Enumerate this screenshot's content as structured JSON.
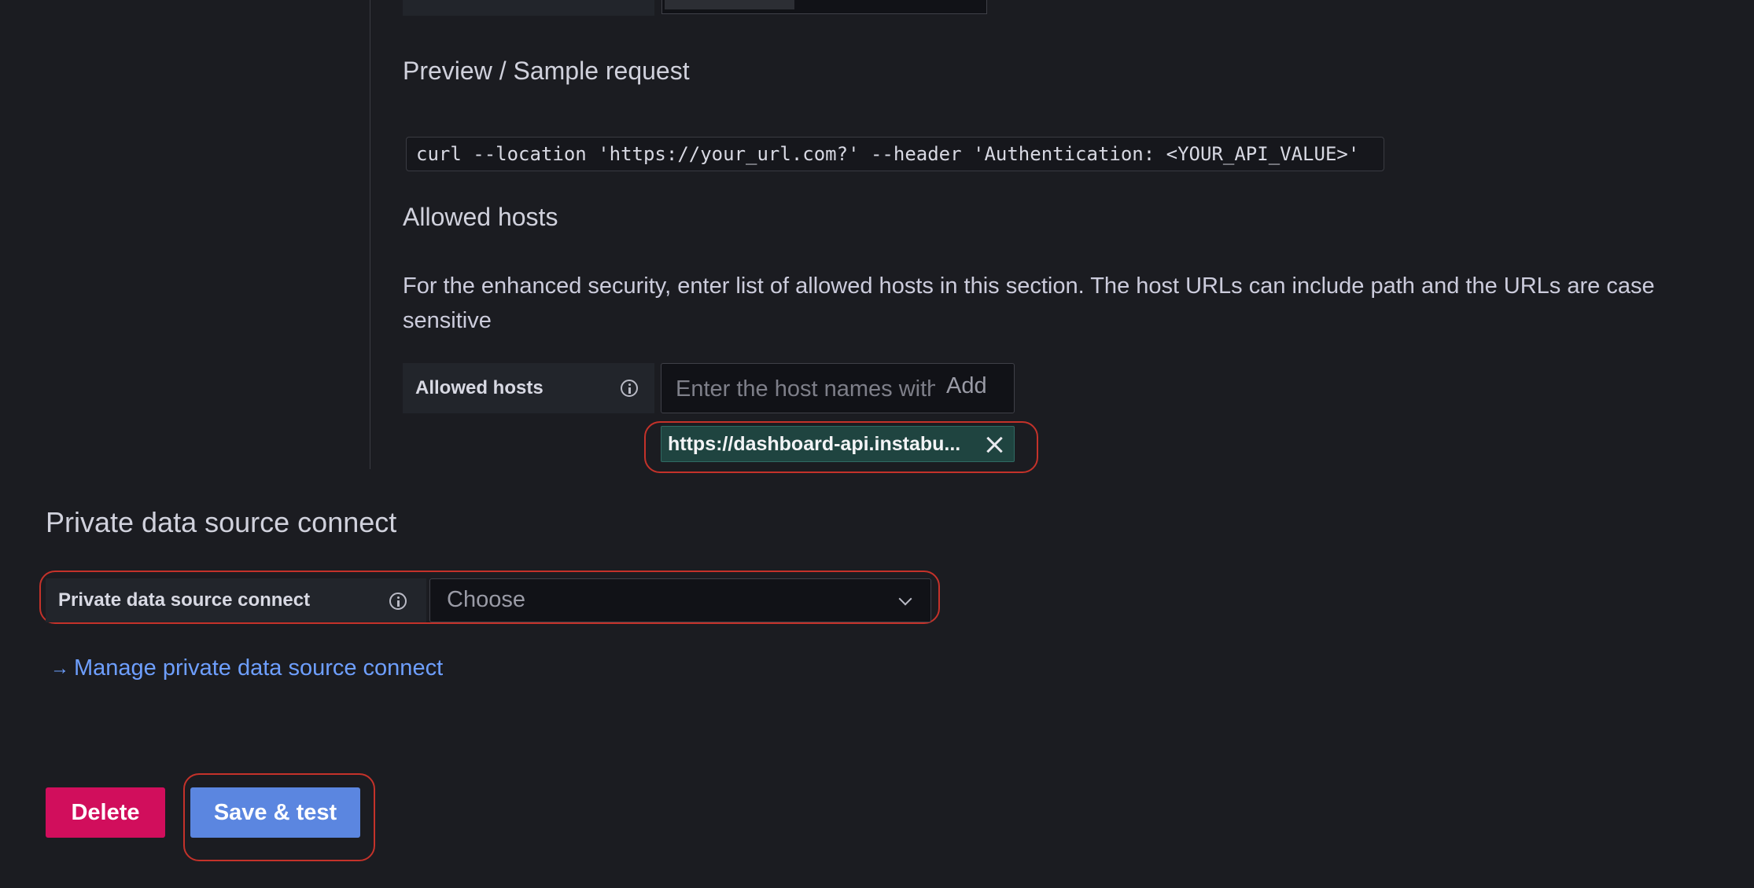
{
  "preview": {
    "heading": "Preview / Sample request",
    "code": "curl --location 'https://your_url.com?' --header 'Authentication: <YOUR_API_VALUE>'"
  },
  "allowed_hosts": {
    "heading": "Allowed hosts",
    "description": "For the enhanced security, enter list of allowed hosts in this section. The host URLs can include path and the URLs are case sensitive",
    "label": "Allowed hosts",
    "input_placeholder": "Enter the host names with",
    "add_label": "Add",
    "chips": [
      "https://dashboard-api.instabu..."
    ]
  },
  "pdc": {
    "heading": "Private data source connect",
    "label": "Private data source connect",
    "select_value": "Choose",
    "manage_link": "Manage private data source connect"
  },
  "actions": {
    "delete_label": "Delete",
    "save_label": "Save & test"
  },
  "colors": {
    "background": "#1b1c21",
    "chip_bg": "#1f4440",
    "delete": "#d10e5c",
    "primary": "#5b86e0",
    "link": "#6e9fff",
    "highlight": "#c4322a"
  },
  "icons": [
    "info-icon",
    "close-icon",
    "chevron-down-icon",
    "arrow-right-icon"
  ]
}
